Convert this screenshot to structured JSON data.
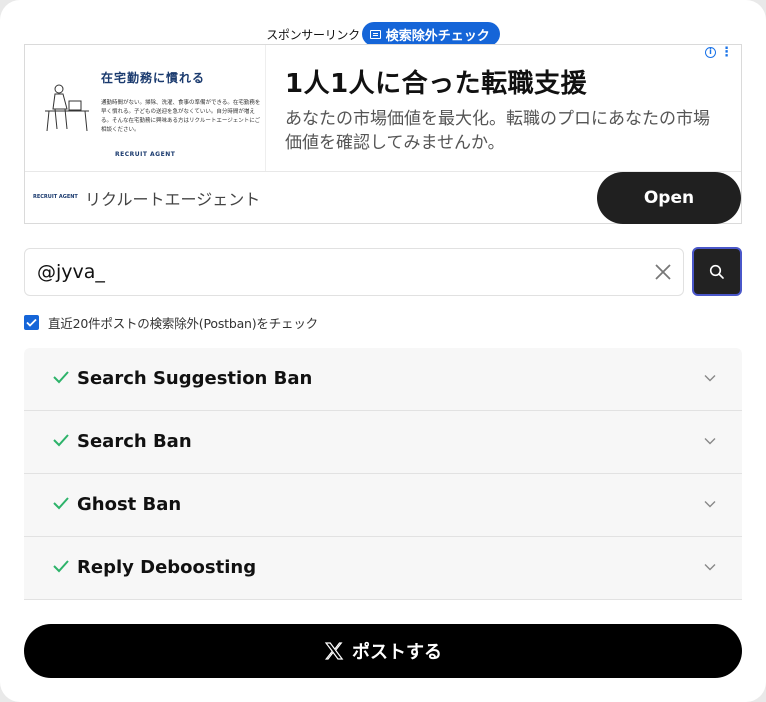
{
  "sponsor": {
    "label": "スポンサーリンク",
    "tool_badge": "検索除外チェック"
  },
  "ad": {
    "thumbnail": {
      "title": "在宅勤務に慣れる",
      "body": "通勤時間がない。掃除、洗濯、食事の準備ができる。在宅勤務を早く慣れる。子どもの送迎を急がなくていい。自分時間が増える。そんな在宅勤務に興味ある方はリクルートエージェントにご相談ください。",
      "logo": "RECRUIT AGENT"
    },
    "headline": "1人1人に合った転職支援",
    "description": "あなたの市場価値を最大化。転職のプロにあなたの市場価値を確認してみませんか。",
    "advertiser_logo": "RECRUIT AGENT",
    "advertiser_name": "リクルートエージェント",
    "cta": "Open"
  },
  "search": {
    "value": "@jyva_"
  },
  "checkbox": {
    "label": "直近20件ポストの検索除外(Postban)をチェック",
    "checked": true
  },
  "checks": [
    {
      "label": "Search Suggestion Ban",
      "status": "ok"
    },
    {
      "label": "Search Ban",
      "status": "ok"
    },
    {
      "label": "Ghost Ban",
      "status": "ok"
    },
    {
      "label": "Reply Deboosting",
      "status": "ok"
    }
  ],
  "post_button": {
    "label": "ポストする"
  },
  "colors": {
    "accent": "#1565d8",
    "check_green": "#2db36a",
    "dark": "#222222"
  }
}
